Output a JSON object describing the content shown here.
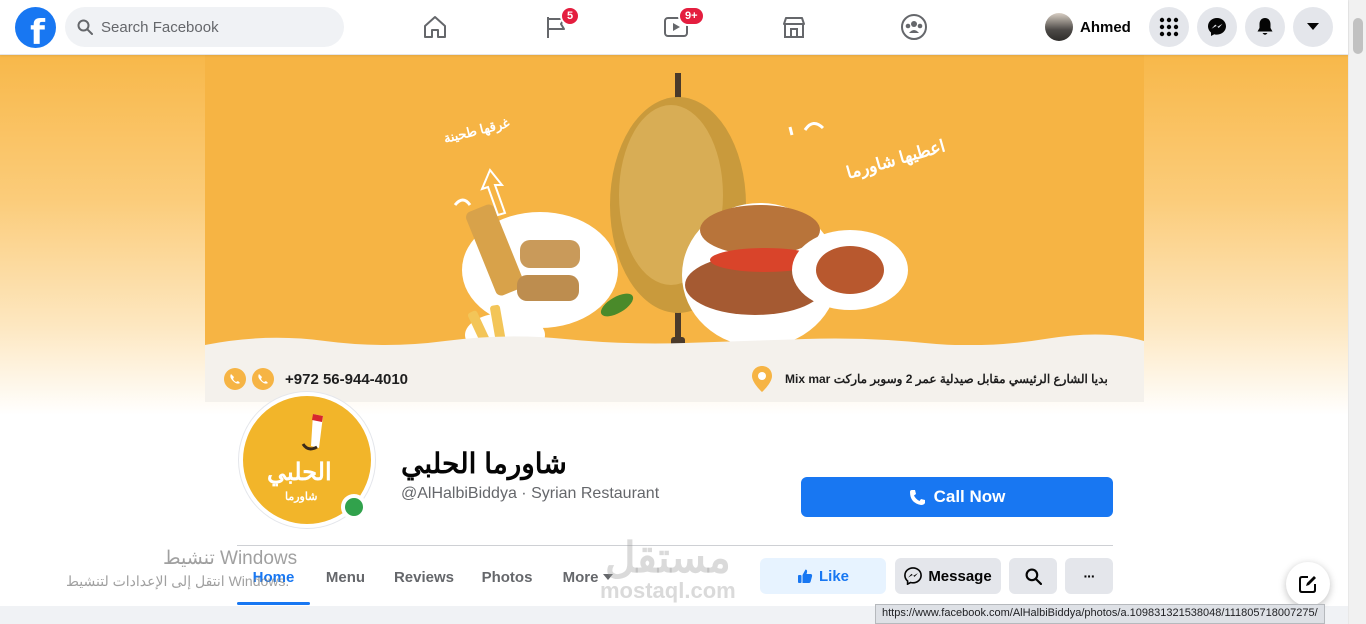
{
  "topbar": {
    "search_placeholder": "Search Facebook",
    "badges": {
      "pages": "5",
      "watch": "9+"
    },
    "profile_name": "Ahmed"
  },
  "cover": {
    "phone": "+972 56-944-4010",
    "address": "بديا الشارع الرئيسي مقابل صيدلية عمر 2 وسوبر ماركت  Mix mar",
    "slogan_left": "غرقها طحينة",
    "slogan_right": "اعطيها شاورما"
  },
  "page": {
    "name": "شاورما الحلبي",
    "subtitle": "@AlHalbiBiddya · Syrian Restaurant",
    "logo_text": "الحلبي",
    "logo_sub": "شاورما",
    "cta_label": "Call Now"
  },
  "tabs": [
    "Home",
    "Menu",
    "Reviews",
    "Photos",
    "More"
  ],
  "actions": {
    "like": "Like",
    "message": "Message",
    "more": "···"
  },
  "overlay": {
    "windows_title": "تنشيط Windows",
    "windows_sub": "انتقل إلى الإعدادات لتنشيط Windows.",
    "watermark_ar": "مستقل",
    "watermark_en": "mostaql.com",
    "status_url": "https://www.facebook.com/AlHalbiBiddya/photos/a.109831321538048/111805718007275/"
  },
  "colors": {
    "accent": "#1877f2",
    "cover": "#f6b444",
    "online": "#31a24c",
    "badge": "#e41e3f"
  },
  "icons": [
    "facebook-logo-icon",
    "search-icon",
    "home-icon",
    "flag-icon",
    "video-icon",
    "marketplace-icon",
    "groups-icon",
    "menu-grid-icon",
    "messenger-icon",
    "bell-icon",
    "caret-down-icon",
    "phone-icon",
    "thumbs-up-icon",
    "messenger-icon",
    "search-icon",
    "more-icon",
    "compose-icon",
    "whatsapp-icon",
    "location-pin-icon"
  ]
}
